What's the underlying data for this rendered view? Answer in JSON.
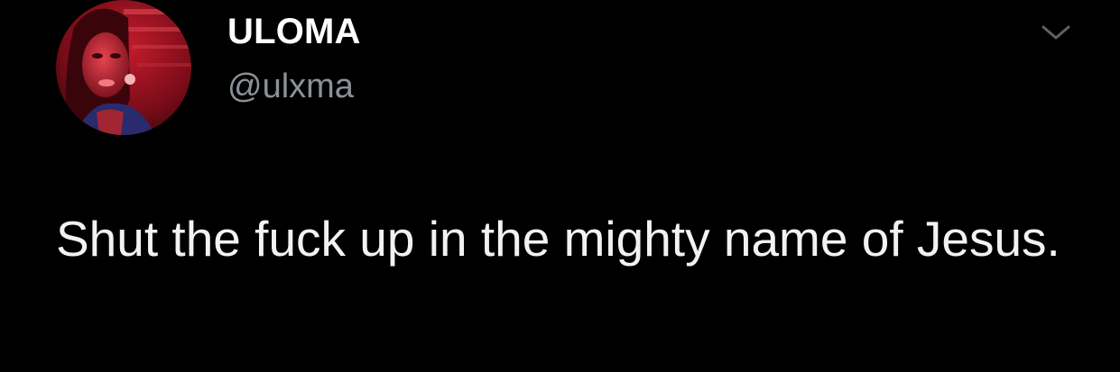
{
  "tweet": {
    "display_name": "ULOMA",
    "handle": "@ulxma",
    "text": "Shut the fuck up in the mighty name of Jesus."
  },
  "icons": {
    "menu": "chevron-down-icon",
    "avatar": "profile-photo"
  },
  "colors": {
    "background": "#000000",
    "name": "#ffffff",
    "handle": "#8b9199",
    "text": "#f2f2f2",
    "chevron": "#5b6168"
  }
}
